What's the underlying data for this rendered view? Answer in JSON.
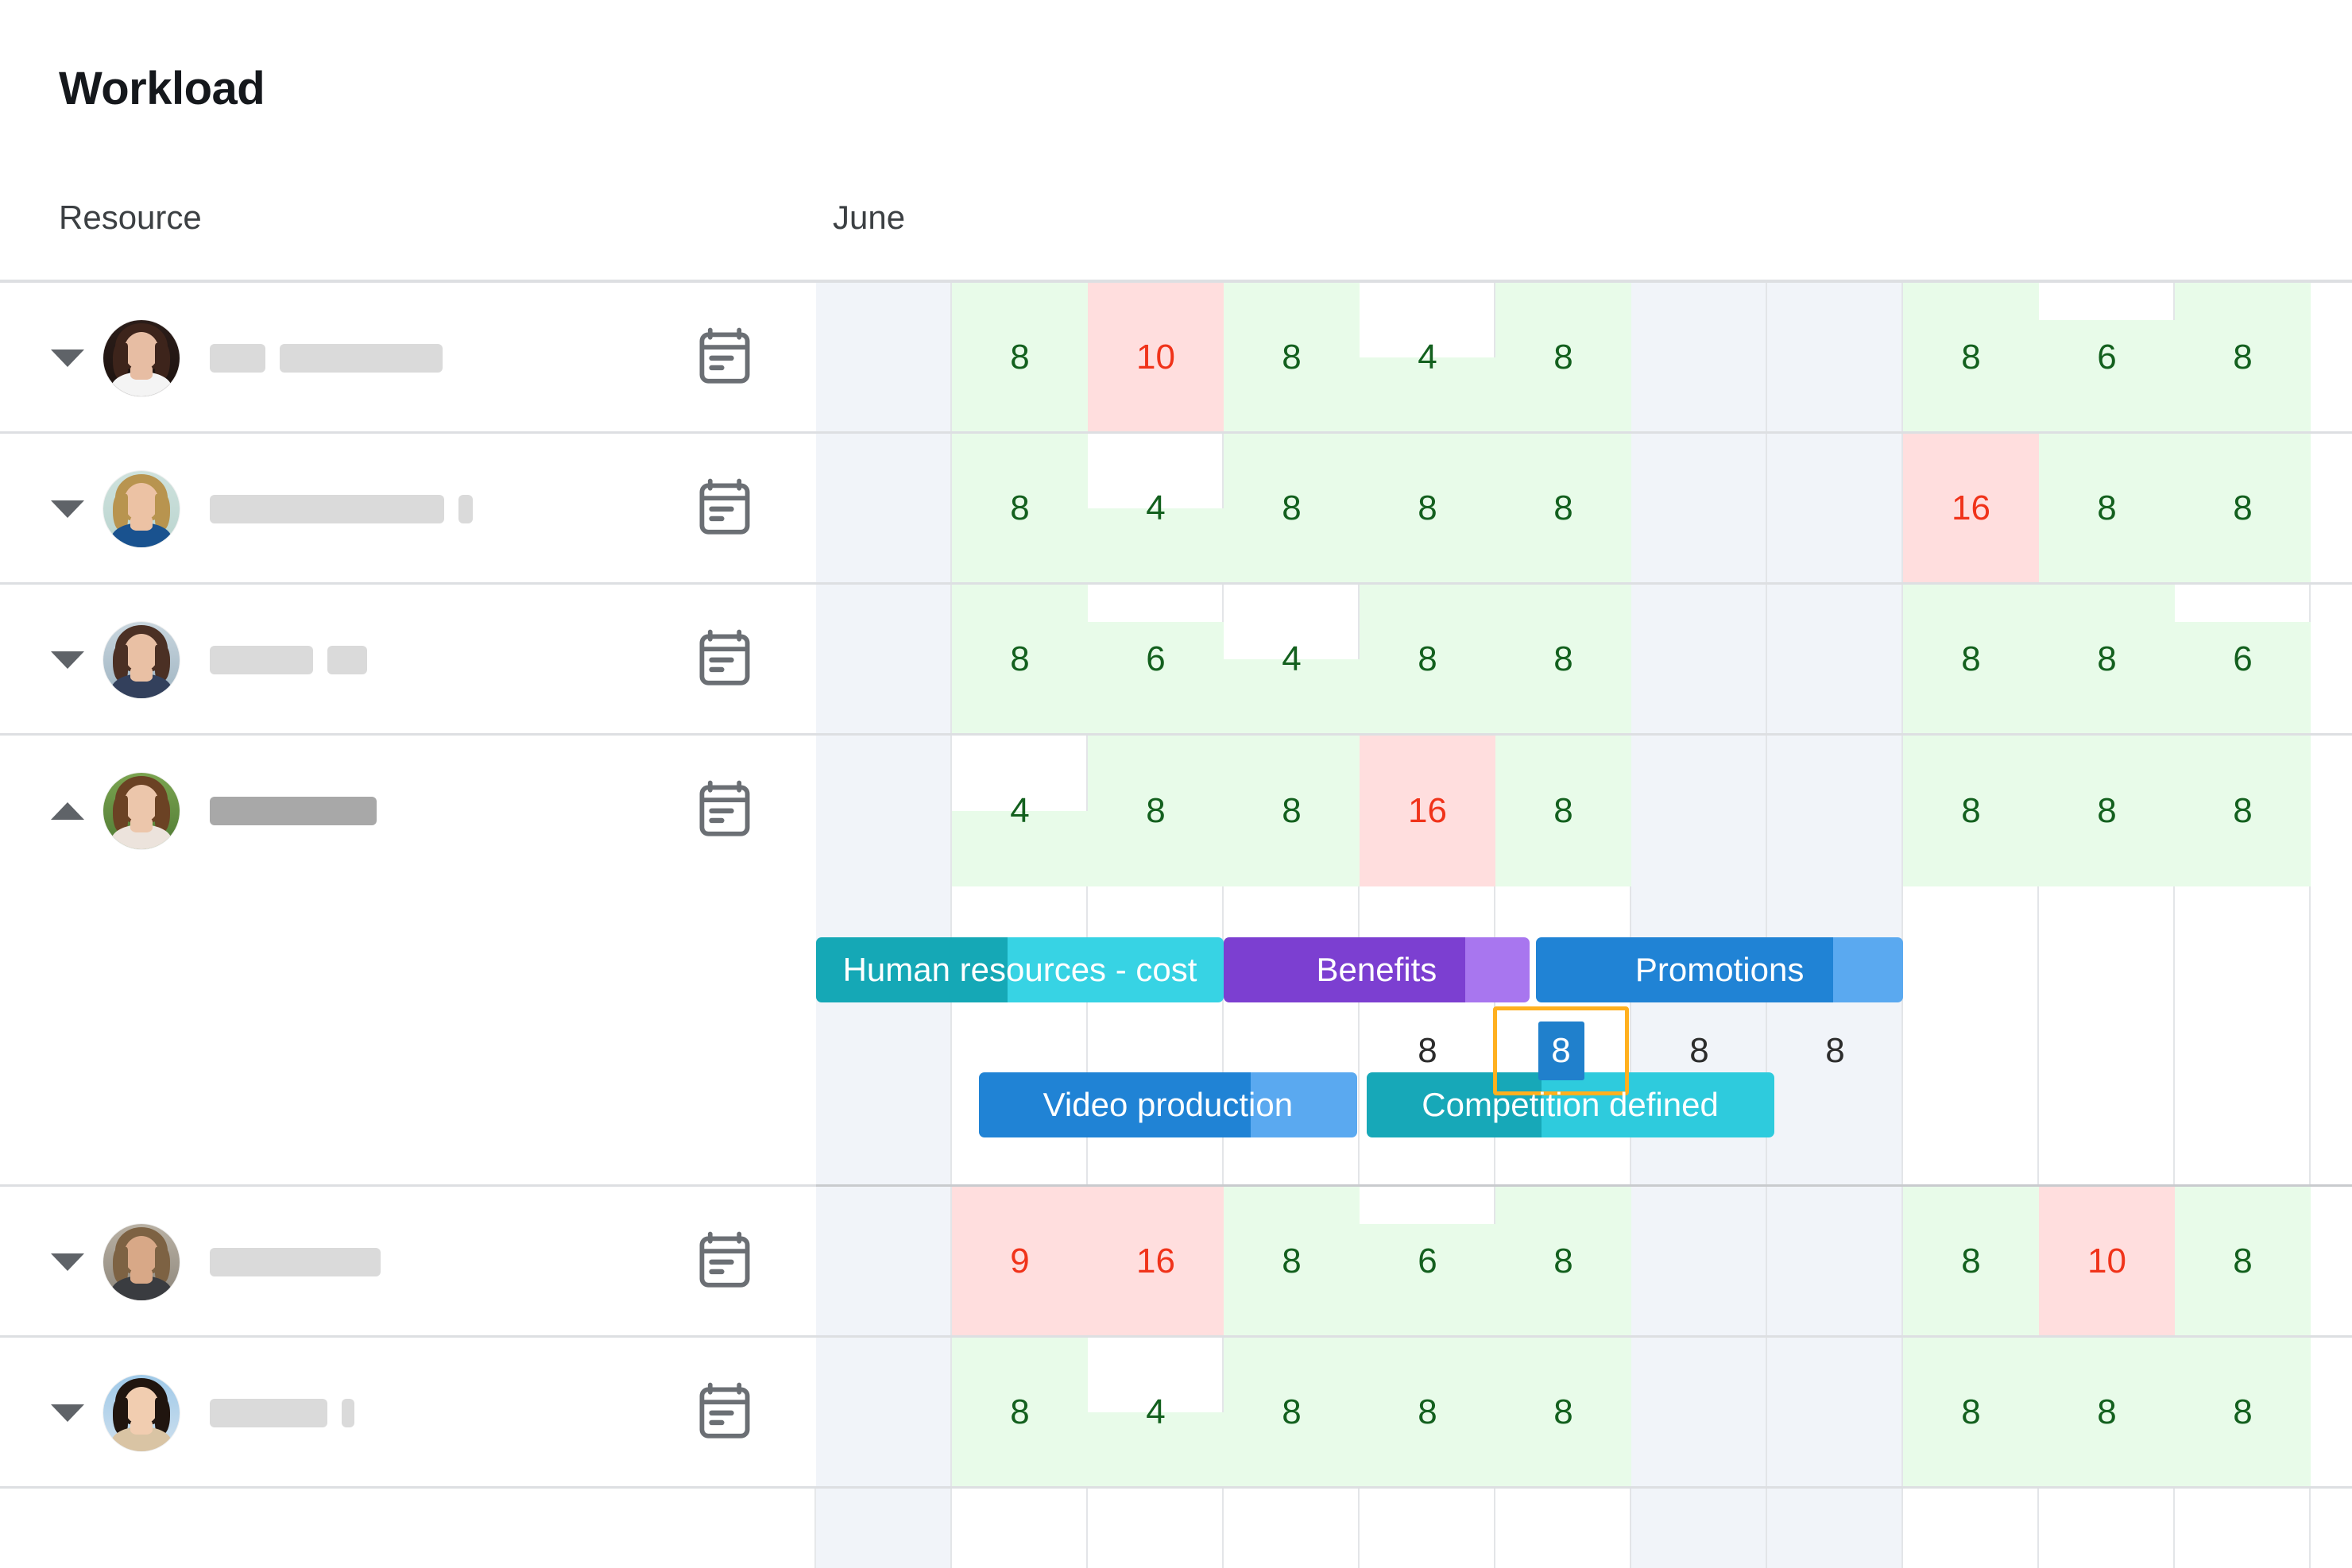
{
  "header": {
    "title": "Workload",
    "resource_column_label": "Resource",
    "month_label": "June"
  },
  "legend": {
    "colors": {
      "overload_cell_bg": "#ffdede",
      "overload_text": "#f0331a",
      "normal_cell_bg": "#e8fbe9",
      "normal_text": "#13601e",
      "weekend_column_bg": "#f1f4f9",
      "selection_border": "#ffb01f",
      "selection_chip": "#2080cc",
      "grid_line": "#e3e5e8",
      "row_divider": "#dddfe2"
    }
  },
  "columns": [
    {
      "index": 0,
      "weekend": true
    },
    {
      "index": 1,
      "weekend": false
    },
    {
      "index": 2,
      "weekend": false
    },
    {
      "index": 3,
      "weekend": false
    },
    {
      "index": 4,
      "weekend": false
    },
    {
      "index": 5,
      "weekend": false
    },
    {
      "index": 6,
      "weekend": true
    },
    {
      "index": 7,
      "weekend": true
    },
    {
      "index": 8,
      "weekend": false
    },
    {
      "index": 9,
      "weekend": false
    },
    {
      "index": 10,
      "weekend": false
    },
    {
      "index": 11,
      "weekend": false
    }
  ],
  "rows": [
    {
      "id": "row-1",
      "expanded": false,
      "chevron": "chevron-down-icon",
      "calendar_icon": "calendar-icon",
      "avatar": "avatar-woman-white-top",
      "name_bars": [
        70,
        205
      ],
      "name_bar_style": "light",
      "cells": [
        {
          "col": 0,
          "value": null
        },
        {
          "col": 1,
          "value": 8,
          "state": "normal"
        },
        {
          "col": 2,
          "value": 10,
          "state": "overload"
        },
        {
          "col": 3,
          "value": 8,
          "state": "normal"
        },
        {
          "col": 4,
          "value": 4,
          "state": "normal"
        },
        {
          "col": 5,
          "value": 8,
          "state": "normal"
        },
        {
          "col": 6,
          "value": null
        },
        {
          "col": 7,
          "value": null
        },
        {
          "col": 8,
          "value": 8,
          "state": "normal"
        },
        {
          "col": 9,
          "value": 6,
          "state": "normal"
        },
        {
          "col": 10,
          "value": 8,
          "state": "normal"
        },
        {
          "col": 11,
          "value": null
        }
      ]
    },
    {
      "id": "row-2",
      "expanded": false,
      "chevron": "chevron-down-icon",
      "calendar_icon": "calendar-icon",
      "avatar": "avatar-man-blue-jacket",
      "name_bars": [
        295,
        18
      ],
      "name_bar_style": "light",
      "cells": [
        {
          "col": 0,
          "value": null
        },
        {
          "col": 1,
          "value": 8,
          "state": "normal"
        },
        {
          "col": 2,
          "value": 4,
          "state": "normal"
        },
        {
          "col": 3,
          "value": 8,
          "state": "normal"
        },
        {
          "col": 4,
          "value": 8,
          "state": "normal"
        },
        {
          "col": 5,
          "value": 8,
          "state": "normal"
        },
        {
          "col": 6,
          "value": null
        },
        {
          "col": 7,
          "value": null
        },
        {
          "col": 8,
          "value": 16,
          "state": "overload"
        },
        {
          "col": 9,
          "value": 8,
          "state": "normal"
        },
        {
          "col": 10,
          "value": 8,
          "state": "normal"
        },
        {
          "col": 11,
          "value": null
        }
      ]
    },
    {
      "id": "row-3",
      "expanded": false,
      "chevron": "chevron-down-icon",
      "calendar_icon": "calendar-icon",
      "avatar": "avatar-woman-patterned-top",
      "name_bars": [
        130,
        50
      ],
      "name_bar_style": "light",
      "cells": [
        {
          "col": 0,
          "value": null
        },
        {
          "col": 1,
          "value": 8,
          "state": "normal"
        },
        {
          "col": 2,
          "value": 6,
          "state": "normal"
        },
        {
          "col": 3,
          "value": 4,
          "state": "normal"
        },
        {
          "col": 4,
          "value": 8,
          "state": "normal"
        },
        {
          "col": 5,
          "value": 8,
          "state": "normal"
        },
        {
          "col": 6,
          "value": null
        },
        {
          "col": 7,
          "value": null
        },
        {
          "col": 8,
          "value": 8,
          "state": "normal"
        },
        {
          "col": 9,
          "value": 8,
          "state": "normal"
        },
        {
          "col": 10,
          "value": 6,
          "state": "normal"
        },
        {
          "col": 11,
          "value": null
        }
      ]
    },
    {
      "id": "row-4",
      "expanded": true,
      "chevron": "chevron-up-icon",
      "calendar_icon": "calendar-icon",
      "avatar": "avatar-woman-long-hair-outdoors",
      "name_bars": [
        210
      ],
      "name_bar_style": "dark",
      "cells": [
        {
          "col": 0,
          "value": null
        },
        {
          "col": 1,
          "value": 4,
          "state": "normal"
        },
        {
          "col": 2,
          "value": 8,
          "state": "normal"
        },
        {
          "col": 3,
          "value": 8,
          "state": "normal"
        },
        {
          "col": 4,
          "value": 16,
          "state": "overload"
        },
        {
          "col": 5,
          "value": 8,
          "state": "normal"
        },
        {
          "col": 6,
          "value": null
        },
        {
          "col": 7,
          "value": null
        },
        {
          "col": 8,
          "value": 8,
          "state": "normal"
        },
        {
          "col": 9,
          "value": 8,
          "state": "normal"
        },
        {
          "col": 10,
          "value": 8,
          "state": "normal"
        },
        {
          "col": 11,
          "value": null
        }
      ]
    },
    {
      "id": "row-5",
      "expanded": false,
      "chevron": "chevron-down-icon",
      "calendar_icon": "calendar-icon",
      "avatar": "avatar-man-beard-grey-shirt",
      "name_bars": [
        215
      ],
      "name_bar_style": "light",
      "cells": [
        {
          "col": 0,
          "value": null
        },
        {
          "col": 1,
          "value": 9,
          "state": "overload"
        },
        {
          "col": 2,
          "value": 16,
          "state": "overload"
        },
        {
          "col": 3,
          "value": 8,
          "state": "normal"
        },
        {
          "col": 4,
          "value": 6,
          "state": "normal"
        },
        {
          "col": 5,
          "value": 8,
          "state": "normal"
        },
        {
          "col": 6,
          "value": null
        },
        {
          "col": 7,
          "value": null
        },
        {
          "col": 8,
          "value": 8,
          "state": "normal"
        },
        {
          "col": 9,
          "value": 10,
          "state": "overload"
        },
        {
          "col": 10,
          "value": 8,
          "state": "normal"
        },
        {
          "col": 11,
          "value": null
        }
      ]
    },
    {
      "id": "row-6",
      "expanded": false,
      "chevron": "chevron-down-icon",
      "calendar_icon": "calendar-icon",
      "avatar": "avatar-woman-city-background",
      "name_bars": [
        148,
        16
      ],
      "name_bar_style": "light",
      "cells": [
        {
          "col": 0,
          "value": null
        },
        {
          "col": 1,
          "value": 8,
          "state": "normal"
        },
        {
          "col": 2,
          "value": 4,
          "state": "normal"
        },
        {
          "col": 3,
          "value": 8,
          "state": "normal"
        },
        {
          "col": 4,
          "value": 8,
          "state": "normal"
        },
        {
          "col": 5,
          "value": 8,
          "state": "normal"
        },
        {
          "col": 6,
          "value": null
        },
        {
          "col": 7,
          "value": null
        },
        {
          "col": 8,
          "value": 8,
          "state": "normal"
        },
        {
          "col": 9,
          "value": 8,
          "state": "normal"
        },
        {
          "col": 10,
          "value": 8,
          "state": "normal"
        },
        {
          "col": 11,
          "value": null
        }
      ]
    }
  ],
  "expanded_detail": {
    "owner_row": "row-4",
    "task_lanes": [
      {
        "lane": 1,
        "tasks": [
          {
            "label": "Human resources - cost",
            "start_col": 0,
            "span_cols": 3.0,
            "progress_pct": 47,
            "progress_color": "#15a8b6",
            "remaining_color": "#37d3e4"
          },
          {
            "label": "Benefits",
            "start_col": 3.0,
            "span_cols": 2.25,
            "progress_pct": 79,
            "progress_color": "#7c3fd1",
            "remaining_color": "#a876ef"
          },
          {
            "label": "Promotions",
            "start_col": 5.3,
            "span_cols": 2.7,
            "progress_pct": 81,
            "progress_color": "#2083d5",
            "remaining_color": "#5aa9f0"
          }
        ]
      },
      {
        "lane": 2,
        "tasks": [
          {
            "label": "Video production",
            "start_col": 1.2,
            "span_cols": 2.78,
            "progress_pct": 72,
            "progress_color": "#2083d5",
            "remaining_color": "#5aa9f0"
          },
          {
            "label": "Competition defined",
            "start_col": 4.05,
            "span_cols": 3.0,
            "progress_pct": 43,
            "progress_color": "#17a8b8",
            "remaining_color": "#2ecbdd"
          }
        ]
      }
    ],
    "sub_values": [
      {
        "col": 4,
        "value": 8,
        "selected": false
      },
      {
        "col": 5,
        "value": 8,
        "selected": true
      },
      {
        "col": 6,
        "value": 8,
        "selected": false
      },
      {
        "col": 7,
        "value": 8,
        "selected": false
      }
    ]
  }
}
